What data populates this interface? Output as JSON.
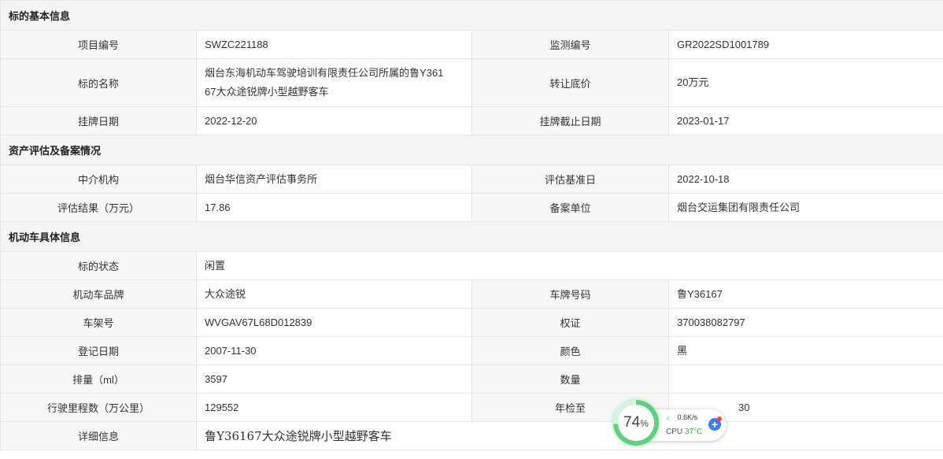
{
  "sections": {
    "basic": {
      "title": "标的基本信息",
      "project_no_label": "项目编号",
      "project_no": "SWZC221188",
      "monitor_no_label": "监测编号",
      "monitor_no": "GR2022SD1001789",
      "name_label": "标的名称",
      "name_line1": "烟台东海机动车驾驶培训有限责任公司所属的鲁Y361",
      "name_line2": "67大众途锐牌小型越野客车",
      "price_label": "转让底价",
      "price": "20万元",
      "list_date_label": "挂牌日期",
      "list_date": "2022-12-20",
      "end_date_label": "挂牌截止日期",
      "end_date": "2023-01-17"
    },
    "assessment": {
      "title": "资产评估及备案情况",
      "agency_label": "中介机构",
      "agency": "烟台华信资产评估事务所",
      "base_date_label": "评估基准日",
      "base_date": "2022-10-18",
      "result_label": "评估结果（万元）",
      "result": "17.86",
      "filing_label": "备案单位",
      "filing": "烟台交运集团有限责任公司"
    },
    "vehicle": {
      "title": "机动车具体信息",
      "status_label": "标的状态",
      "status": "闲置",
      "brand_label": "机动车品牌",
      "brand": "大众途锐",
      "plate_label": "车牌号码",
      "plate": "鲁Y36167",
      "vin_label": "车架号",
      "vin": "WVGAV67L68D012839",
      "cert_label": "权证",
      "cert": "370038082797",
      "reg_date_label": "登记日期",
      "reg_date": "2007-11-30",
      "color_label": "颜色",
      "color": "黑",
      "displacement_label": "排量（ml）",
      "displacement": "3597",
      "quantity_label": "数量",
      "quantity": "",
      "mileage_label": "行驶里程数（万公里）",
      "mileage": "129552",
      "inspection_label": "年检至",
      "inspection_partial": "30",
      "detail_label": "详细信息",
      "detail": "鲁Y36167大众途锐牌小型越野客车"
    }
  },
  "widget": {
    "percent": "74",
    "percent_unit": "%",
    "percent_value": 74,
    "net_speed": "0.6K/s",
    "cpu_label": "CPU",
    "cpu_temp": "37°C",
    "boost_symbol": "+",
    "down_arrow": "↓",
    "ring_color": "#5fd07f",
    "boost_color": "#3b7cf0"
  }
}
